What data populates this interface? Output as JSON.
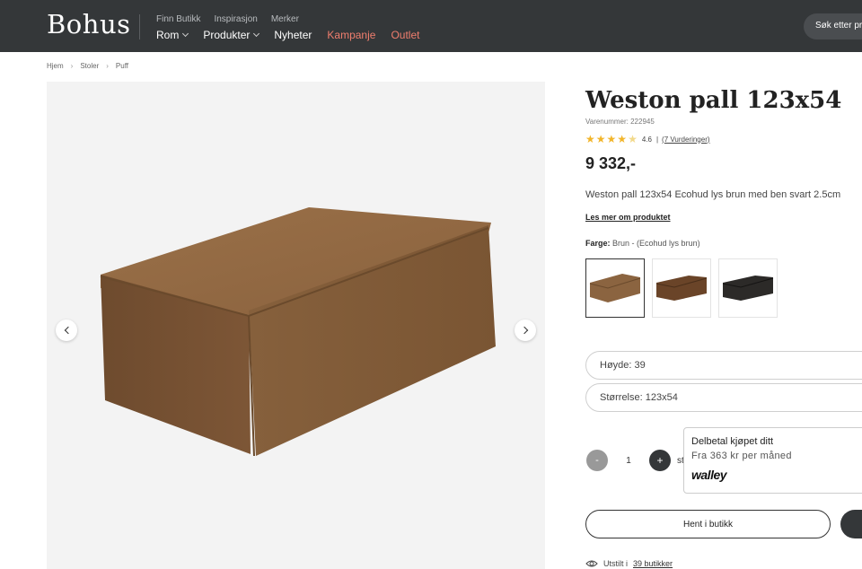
{
  "header": {
    "logo": "Bohus",
    "top_links": [
      "Finn Butikk",
      "Inspirasjon",
      "Merker"
    ],
    "nav": [
      {
        "label": "Rom",
        "dropdown": true,
        "accent": false
      },
      {
        "label": "Produkter",
        "dropdown": true,
        "accent": false
      },
      {
        "label": "Nyheter",
        "dropdown": false,
        "accent": false
      },
      {
        "label": "Kampanje",
        "dropdown": false,
        "accent": true
      },
      {
        "label": "Outlet",
        "dropdown": false,
        "accent": true
      }
    ],
    "search_label": "Søk etter pr"
  },
  "breadcrumb": [
    "Hjem",
    "Stoler",
    "Puff"
  ],
  "product": {
    "title": "Weston pall 123x54",
    "sku": "Varenummer: 222945",
    "rating_value": "4.6",
    "rating_stars": 4.5,
    "rating_count": "(7 Vurderinger)",
    "price": "9 332,-",
    "description": "Weston pall 123x54 Ecohud lys brun med ben svart 2.5cm",
    "read_more": "Les mer om produktet",
    "color_label": "Farge:",
    "color_value": "Brun - (Ecohud lys brun)",
    "swatches": [
      {
        "name": "brun",
        "color": "#8b6440"
      },
      {
        "name": "mørk brun",
        "color": "#6a4428"
      },
      {
        "name": "svart",
        "color": "#2c2a28"
      }
    ],
    "height": "Høyde: 39",
    "size": "Størrelse: 123x54"
  },
  "quantity": {
    "minus": "-",
    "value": "1",
    "plus": "+",
    "unit": "stk"
  },
  "walley": {
    "title": "Delbetal kjøpet ditt",
    "subtitle": "Fra 363 kr per måned",
    "logo": "walley"
  },
  "actions": {
    "pickup": "Hent i butikk"
  },
  "stock": {
    "prefix": "Utstilt i",
    "link": "39 butikker"
  },
  "colors": {
    "header_bg": "#343739",
    "accent": "#f07e6e",
    "star": "#f2b52a"
  }
}
